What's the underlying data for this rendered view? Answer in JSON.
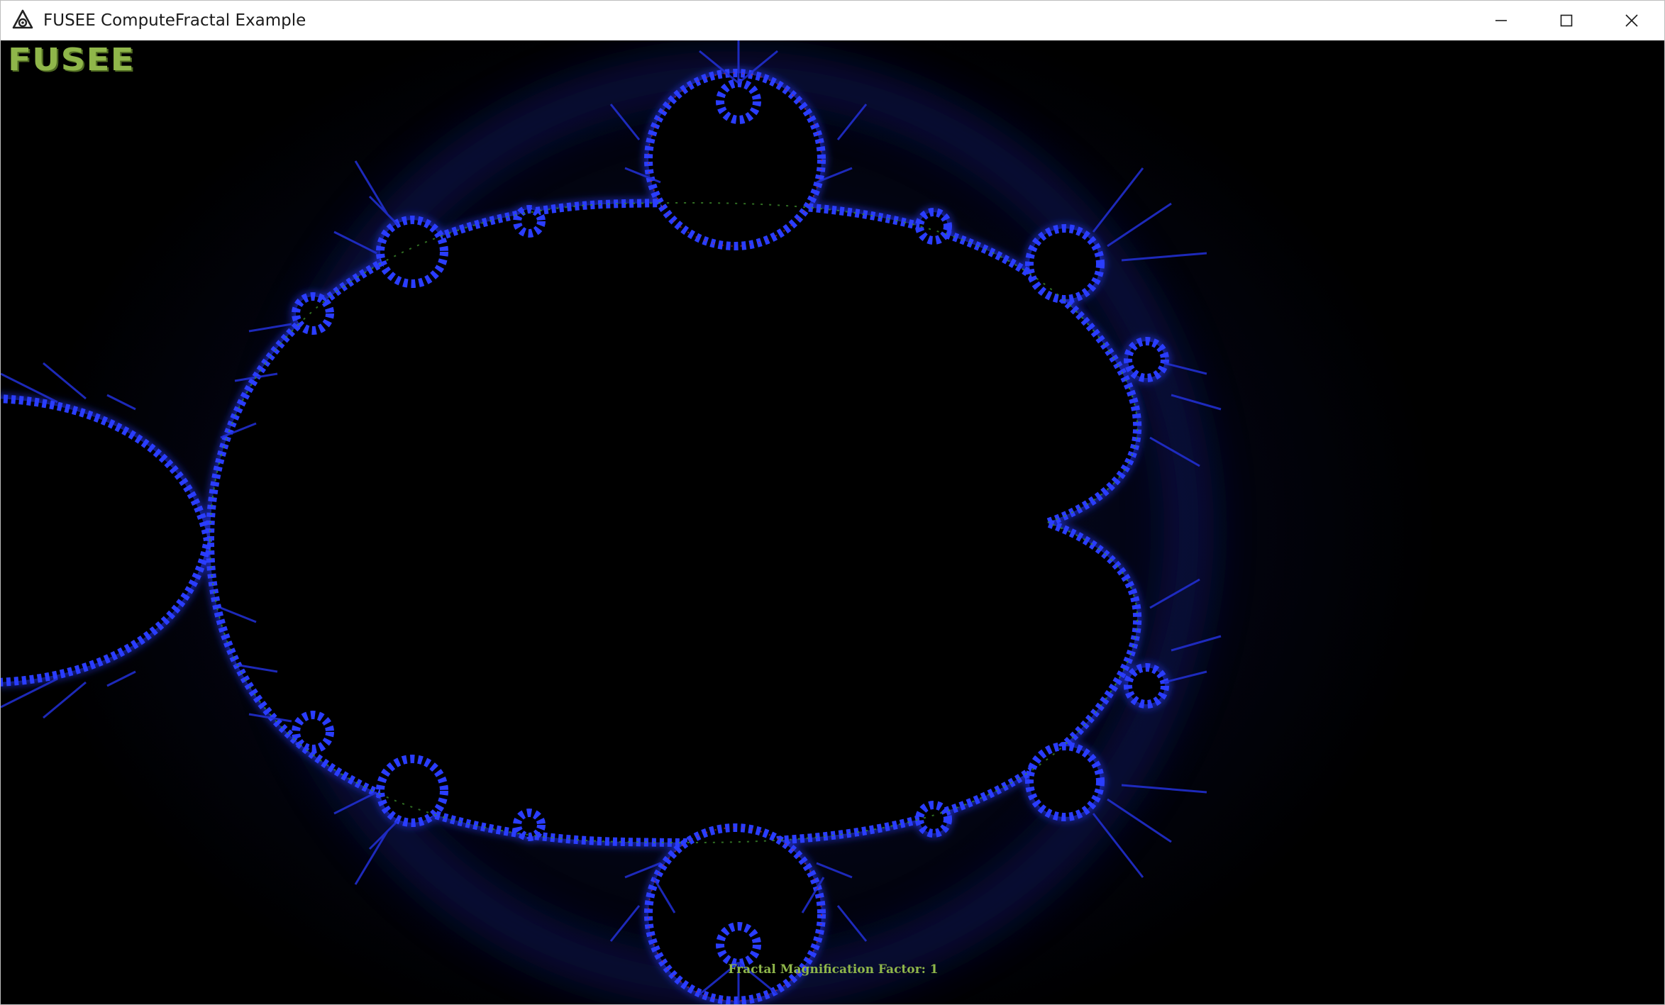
{
  "window": {
    "title": "FUSEE ComputeFractal Example",
    "controls": {
      "minimize_icon": "minimize-icon",
      "maximize_icon": "maximize-icon",
      "close_icon": "close-icon"
    }
  },
  "overlay": {
    "logo_text": "FUSEE",
    "caption": "Fractal Magnification Factor: 1"
  },
  "colors": {
    "logo_green": "#8fb64a",
    "fractal_edge": "#2a3cff",
    "background": "#000000"
  }
}
